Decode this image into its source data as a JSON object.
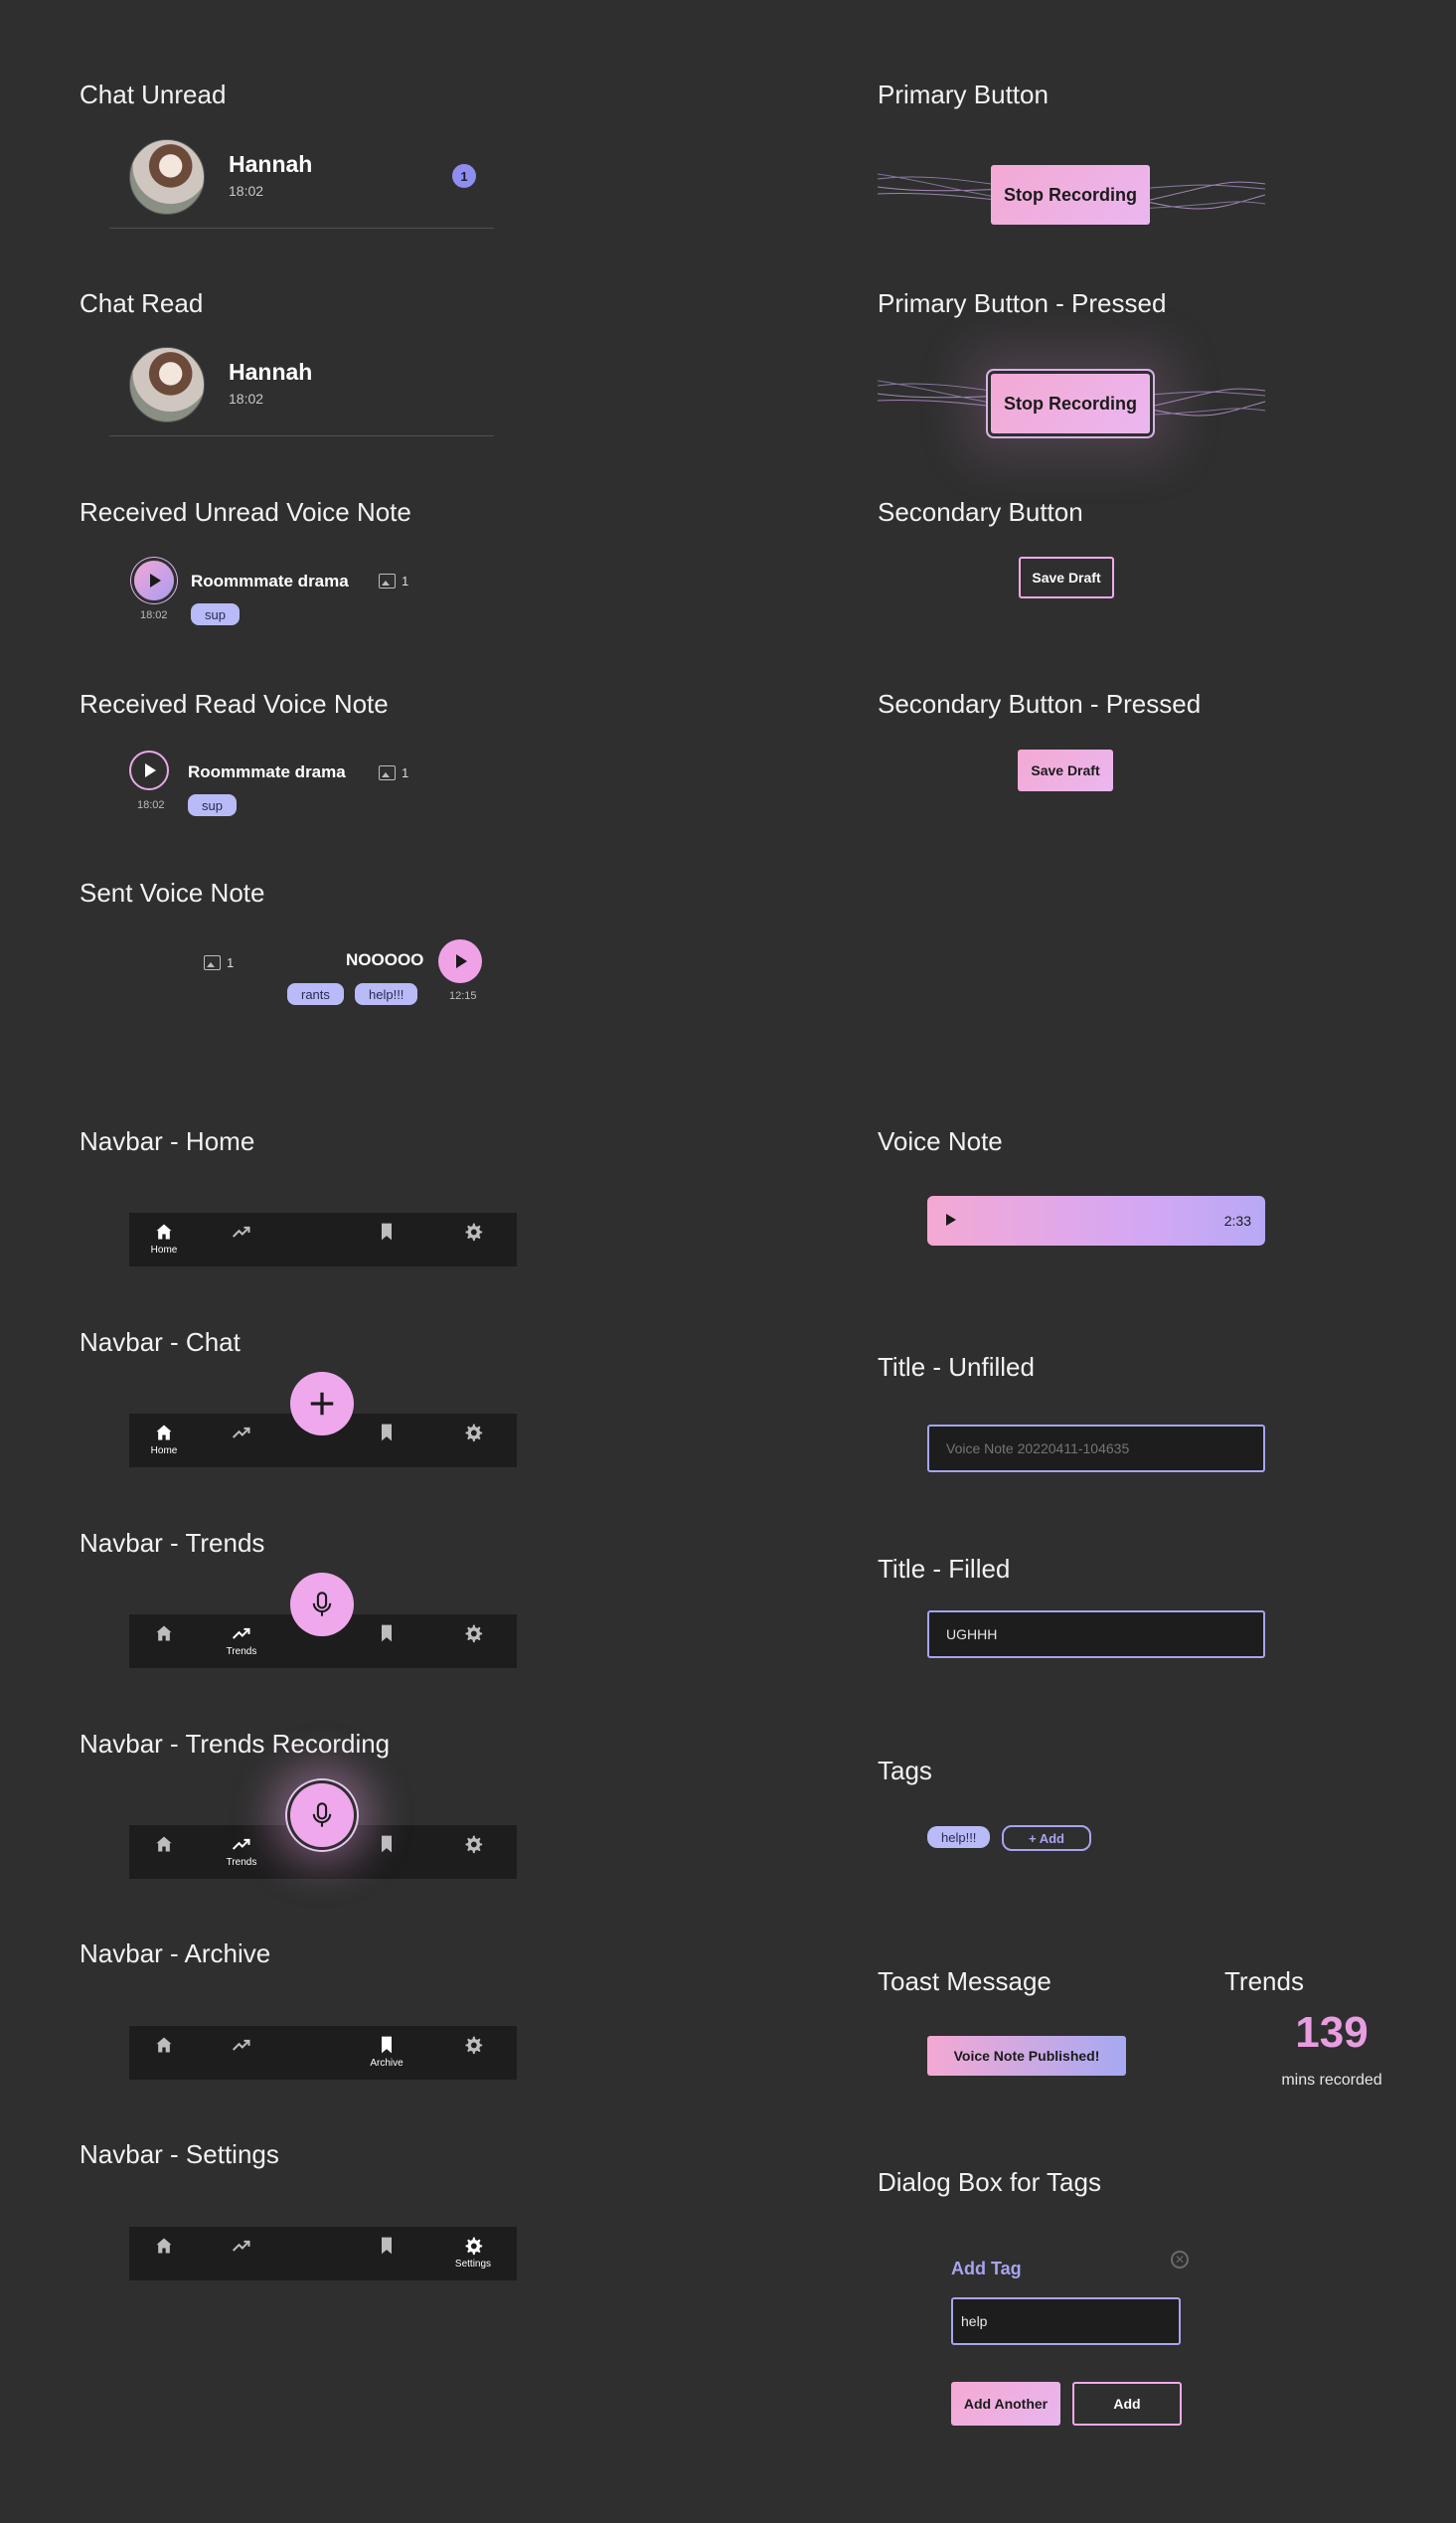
{
  "sections": {
    "chat_unread": "Chat Unread",
    "chat_read": "Chat Read",
    "received_unread_vn": "Received Unread Voice Note",
    "received_read_vn": "Received Read Voice Note",
    "sent_vn": "Sent Voice Note",
    "navbar_home": "Navbar - Home",
    "navbar_chat": "Navbar - Chat",
    "navbar_trends": "Navbar - Trends",
    "navbar_trends_recording": "Navbar - Trends Recording",
    "navbar_archive": "Navbar - Archive",
    "navbar_settings": "Navbar - Settings",
    "primary_button": "Primary Button",
    "primary_button_pressed": "Primary Button - Pressed",
    "secondary_button": "Secondary Button",
    "secondary_button_pressed": "Secondary Button - Pressed",
    "voice_note": "Voice Note",
    "title_unfilled": "Title - Unfilled",
    "title_filled": "Title - Filled",
    "tags": "Tags",
    "toast_message": "Toast Message",
    "trends": "Trends",
    "dialog_box": "Dialog Box for Tags"
  },
  "chat": {
    "name": "Hannah",
    "time": "18:02",
    "unread_count": "1"
  },
  "received_vn": {
    "title": "Roommmate drama",
    "time": "18:02",
    "tag": "sup",
    "image_count": "1"
  },
  "sent_vn": {
    "title": "NOOOOO",
    "time": "12:15",
    "tags": [
      "rants",
      "help!!!"
    ],
    "image_count": "1"
  },
  "navbar": {
    "home_label": "Home",
    "trends_label": "Trends",
    "archive_label": "Archive",
    "settings_label": "Settings"
  },
  "buttons": {
    "primary_label": "Stop Recording",
    "secondary_label": "Save Draft"
  },
  "voice_note_bar": {
    "duration": "2:33"
  },
  "title_field": {
    "unfilled_placeholder": "Voice Note 20220411-104635",
    "filled_value": "UGHHH"
  },
  "tags_component": {
    "tag": "help!!!",
    "add_label": "+ Add"
  },
  "toast": {
    "message": "Voice Note Published!"
  },
  "trends_stat": {
    "value": "139",
    "label": "mins recorded"
  },
  "dialog": {
    "title": "Add Tag",
    "input_value": "help",
    "add_another_label": "Add Another",
    "add_label": "Add"
  },
  "colors": {
    "background": "#2f2f2f",
    "pink": "#f0a8ec",
    "lavender": "#a7a4ee",
    "navbar": "#1d1d1d"
  }
}
